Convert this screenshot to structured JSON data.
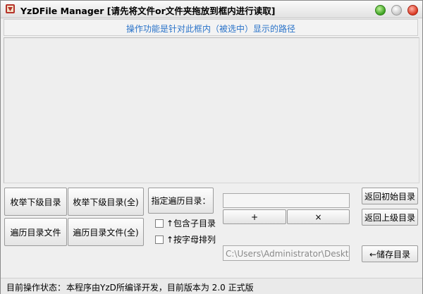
{
  "window": {
    "title": "YzDFile Manager  [请先将文件or文件夹拖放到框内进行读取]",
    "colors": {
      "info_text": "#2a73c9",
      "min_button": "#3aa11f",
      "close_button": "#d9361f"
    }
  },
  "infobar": {
    "text": "操作功能是针对此框内（被选中）显示的路径"
  },
  "buttons": {
    "enumerate_subdirs": "枚举下级目录",
    "enumerate_subdirs_all": "枚举下级目录(全)",
    "traverse_files": "遍历目录文件",
    "traverse_files_all": "遍历目录文件(全)",
    "specify_traverse_dir": "指定遍历目录：",
    "add": "+",
    "remove": "×",
    "return_initial": "返回初始目录",
    "return_parent": "返回上级目录",
    "save_dir": "←储存目录"
  },
  "checkboxes": {
    "include_subdirs": "↑包含子目录",
    "sort_by_letter": "↑按字母排列"
  },
  "fields": {
    "traverse_dir_value": "",
    "path_value": "C:\\Users\\Administrator\\Desktop"
  },
  "status": {
    "label": "目前操作状态：",
    "text": "本程序由YzD所编译开发，目前版本为 2.0 正式版"
  }
}
